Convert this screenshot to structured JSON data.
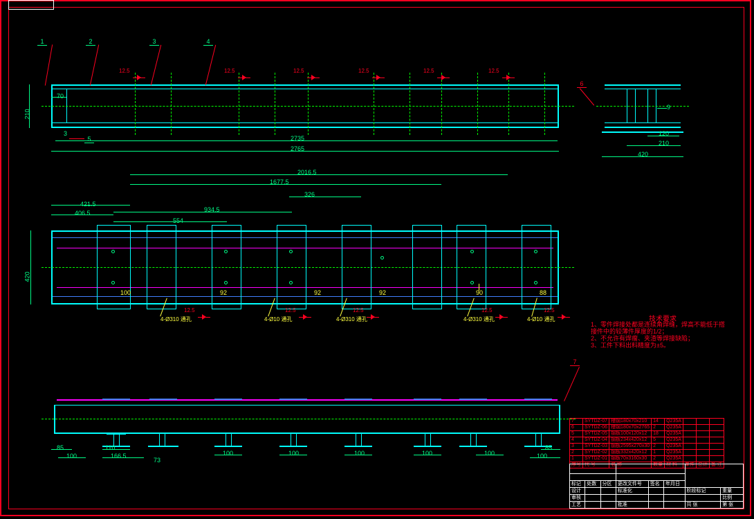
{
  "frame": {
    "outer_w": 1090,
    "outer_h": 750
  },
  "balloons": [
    "1",
    "2",
    "3",
    "4",
    "5",
    "6",
    "7"
  ],
  "weld_value": "12.5",
  "view_top": {
    "dim_h": "210",
    "dim_w_inner": "2735",
    "dim_w_outer": "2765",
    "dim_end_gap": "70",
    "dim_offset": "3"
  },
  "view_side": {
    "dim_web": "9",
    "dim_flange": "120",
    "dim_plate": "210",
    "dim_overall": "420"
  },
  "view_plan": {
    "dim_height": "420",
    "d1": "2016.5",
    "d2": "1677.5",
    "d3": "326",
    "d4": "934.5",
    "d5": "554",
    "d6": "421.5",
    "d7": "406.5",
    "hole_dim_92": "92",
    "hole_dim_90": "90",
    "hole_dim_88": "88",
    "hole_dim_100": "100",
    "hole_call_4c10": "4-Ø10  通孔",
    "hole_call_4c310": "4-Ø310  通孔"
  },
  "view_bottom": {
    "dim_foot": "100",
    "dim_85": "85",
    "dim_110": "110",
    "dim_166": "166.5",
    "dim_x": "73"
  },
  "notes": {
    "title": "技术要求",
    "l1": "1、零件焊接处都是连续角焊缝，焊高不能低于搭",
    "l1b": "接件中的较薄件厚度的1/2；",
    "l2": "2、不允许有焊瘤、夹渣等焊接缺陷；",
    "l3": "3、工件下料出料精度为±5。"
  },
  "bom": {
    "rows": [
      {
        "no": "7",
        "code": "SYTDZ-07",
        "name": "槽钢180x70x210",
        "qty": "14",
        "mat": "Q235A"
      },
      {
        "no": "6",
        "code": "SYTDZ-06",
        "name": "槽钢180x70x2765",
        "qty": "2",
        "mat": "Q235A"
      },
      {
        "no": "5",
        "code": "SYTDZ-05",
        "name": "钢板100x120x12",
        "qty": "18",
        "mat": "Q235A"
      },
      {
        "no": "4",
        "code": "SYTDZ-04",
        "name": "钢板234x420x12",
        "qty": "5",
        "mat": "Q235A"
      },
      {
        "no": "3",
        "code": "SYTDZ-03",
        "name": "钢板2595x270x30",
        "qty": "2",
        "mat": "Q235A"
      },
      {
        "no": "2",
        "code": "SYTDZ-02",
        "name": "钢板332x420x12",
        "qty": "1",
        "mat": "Q235A"
      },
      {
        "no": "1",
        "code": "SYTDZ-01",
        "name": "钢板70x3160x30",
        "qty": "2",
        "mat": "Q235A"
      }
    ],
    "hdr": {
      "no": "序号",
      "code": "代 号",
      "name": "名  称",
      "qty": "数量",
      "mat": "材 料",
      "wt1": "单件",
      "wt2": "总计",
      "rem": "备 注"
    }
  },
  "title_block": {
    "r1a": "标记",
    "r1b": "处数",
    "r1c": "分区",
    "r1d": "更改文件号",
    "r1e": "签名",
    "r1f": "年月日",
    "r2a": "设计",
    "r2b": "标准化",
    "r2c": "阶段标记",
    "r2d": "重量",
    "r2e": "比例",
    "r3a": "审核",
    "r4a": "工艺",
    "r4b": "批准",
    "r5a": "共 张",
    "r5b": "第 张"
  }
}
